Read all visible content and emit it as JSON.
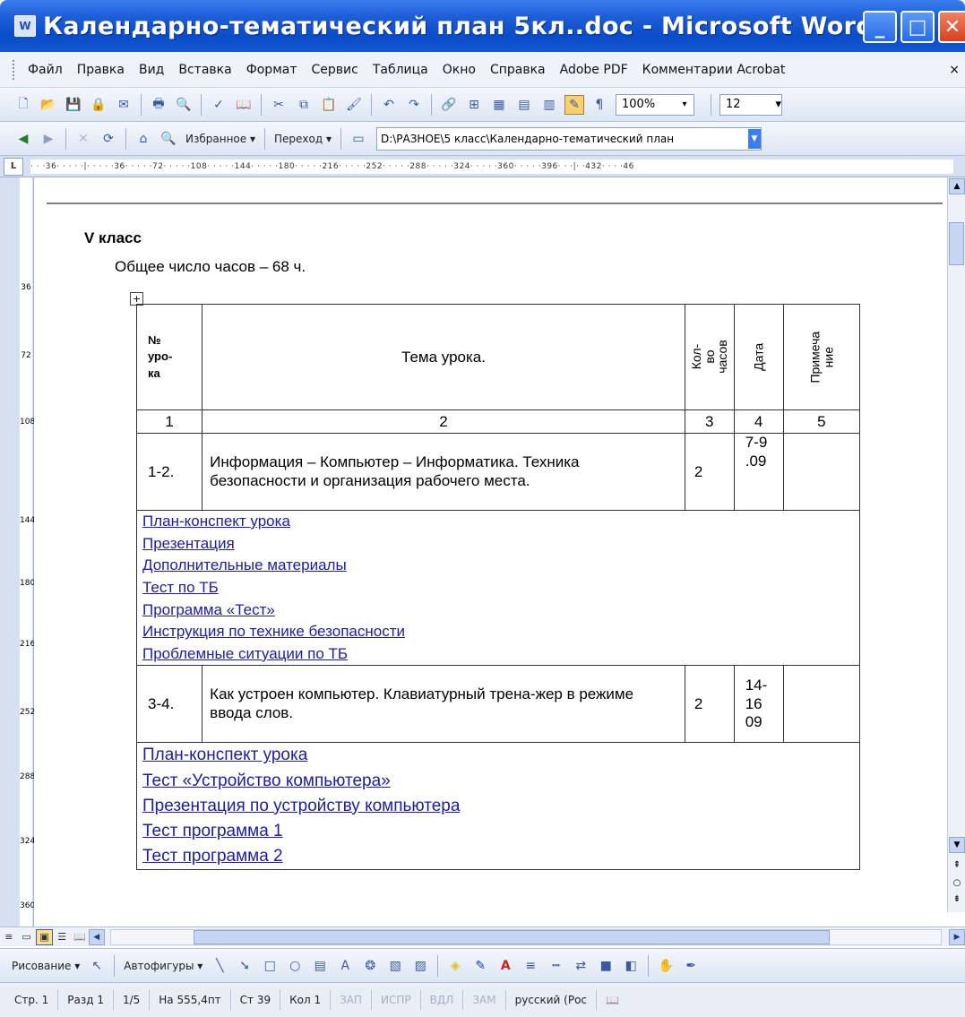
{
  "window": {
    "title": "Календарно-тематический план 5кл..doc - Microsoft Word",
    "app_icon": "W"
  },
  "menu": {
    "items": [
      "Файл",
      "Правка",
      "Вид",
      "Вставка",
      "Формат",
      "Сервис",
      "Таблица",
      "Окно",
      "Справка",
      "Adobe PDF",
      "Комментарии Acrobat"
    ],
    "close": "×"
  },
  "toolbar": {
    "zoom": "100%",
    "font_size": "12",
    "pilcrow": "¶"
  },
  "webbar": {
    "favorites": "Избранное ▾",
    "goto": "Переход ▾",
    "address": "D:\\РАЗНОЕ\\5 класс\\Календарно-тематический план"
  },
  "ruler": {
    "ticks": "· · ·36· · · · ·|· · · · ·36· · · · ·72· · · · ·108· · · · ·144· · · · ·180· · · · ·216· · · · ·252· · · · ·288· · · · ·324· · · · ·360· · · · ·396· · ·|· ·432· · · ·46",
    "vticks": [
      "36",
      "72",
      "108",
      "144",
      "180",
      "216",
      "252",
      "288",
      "324",
      "360"
    ]
  },
  "document": {
    "heading": "V класс",
    "subheading": "Общее число часов – 68 ч.",
    "table": {
      "headers": {
        "num": "№\nуро-\nка",
        "topic": "Тема урока.",
        "hours": "Кол-во\nчасов",
        "date": "Дата",
        "note": "Примеча\nние"
      },
      "index_row": [
        "1",
        "2",
        "3",
        "4",
        "5"
      ],
      "lessons": [
        {
          "num": "1-2.",
          "topic": "Информация – Компьютер – Информатика. Техника безопасности и организация рабочего места.",
          "hours": "2",
          "date": "7-9 .09",
          "links": [
            "План-конспект урока",
            "Презентация",
            "Дополнительные материалы",
            "Тест по ТБ",
            "Программа «Тест»",
            "Инструкция по технике безопасности",
            "Проблемные ситуации по ТБ"
          ]
        },
        {
          "num": "3-4.",
          "topic": "Как устроен компьютер. Клавиатурный трена-жер в режиме ввода слов.",
          "hours": "2",
          "date": "14-16 09",
          "links": [
            "План-конспект урока",
            "Тест «Устройство компьютера»",
            "Презентация по устройству компьютера",
            "Тест программа 1",
            "Тест программа 2"
          ]
        }
      ]
    }
  },
  "drawbar": {
    "draw": "Рисование ▾",
    "autoshapes": "Автофигуры ▾"
  },
  "status": {
    "page": "Стр. 1",
    "section": "Разд 1",
    "pages": "1/5",
    "at": "На 555,4пт",
    "line": "Ст 39",
    "col": "Кол 1",
    "rec": "ЗАП",
    "trk": "ИСПР",
    "ext": "ВДЛ",
    "ovr": "ЗАМ",
    "lang": "русский (Рос"
  }
}
